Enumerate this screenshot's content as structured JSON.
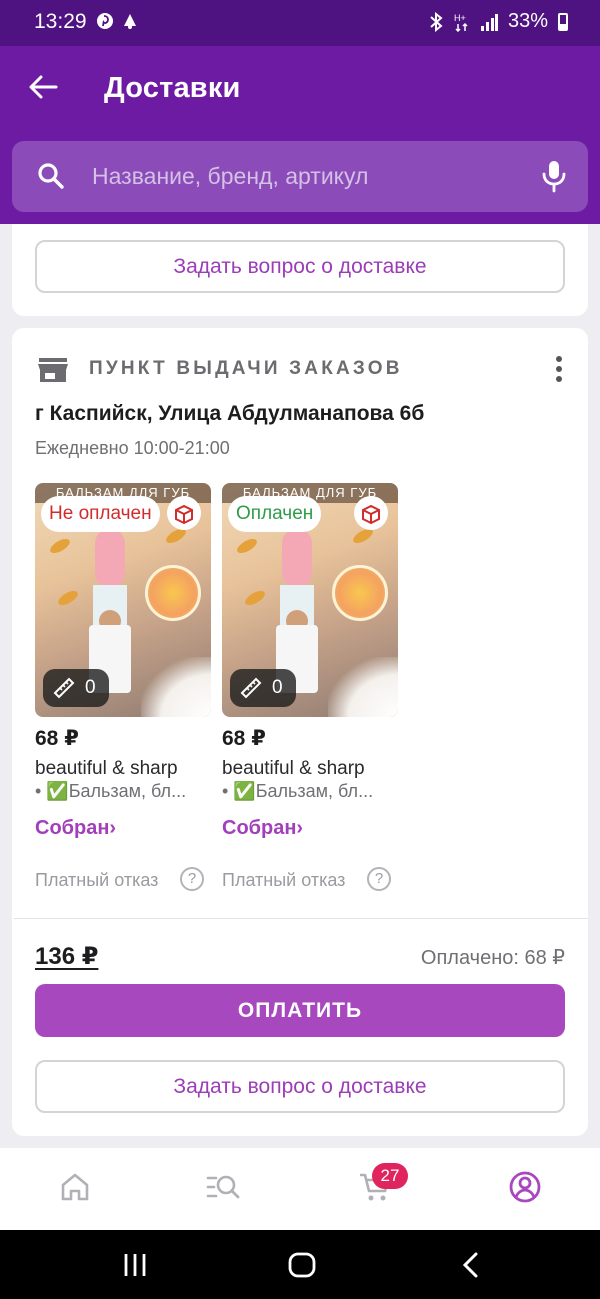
{
  "status_bar": {
    "time": "13:29",
    "battery": "33%",
    "icons": [
      "pinterest-icon",
      "notification-icon",
      "bluetooth-icon",
      "data-icon",
      "signal-icon",
      "battery-icon"
    ]
  },
  "header": {
    "title": "Доставки",
    "back_icon": "arrow-left-icon",
    "search_placeholder": "Название, бренд, артикул"
  },
  "top_card": {
    "ask_button": "Задать вопрос о доставке"
  },
  "delivery": {
    "type_label": "ПУНКТ ВЫДАЧИ ЗАКАЗОВ",
    "address": "г Каспийск, Улица Абдулманапова 6б",
    "hours": "Ежедневно 10:00-21:00",
    "items": [
      {
        "banner": "БАЛЬЗАМ ДЛЯ ГУБ",
        "payment_status": "Не оплачен",
        "status_color": "#d12c2c",
        "fitting_count": "0",
        "price": "68 ₽",
        "brand": "beautiful & sharp",
        "name": "• ✅Бальзам, бл...",
        "status": "Собран›",
        "refusal": "Платный отказ"
      },
      {
        "banner": "БАЛЬЗАМ ДЛЯ ГУБ",
        "payment_status": "Оплачен",
        "status_color": "#2f9c4a",
        "fitting_count": "0",
        "price": "68 ₽",
        "brand": "beautiful & sharp",
        "name": "• ✅Бальзам, бл...",
        "status": "Собран›",
        "refusal": "Платный отказ"
      }
    ],
    "total": "136 ₽",
    "paid": "Оплачено: 68 ₽",
    "pay_button": "ОПЛАТИТЬ",
    "ask_button": "Задать вопрос о доставке"
  },
  "bottom_nav": {
    "items": [
      "home-icon",
      "catalog-icon",
      "cart-icon",
      "profile-icon"
    ],
    "cart_count": "27",
    "active": "profile-icon"
  },
  "colors": {
    "brand_purple": "#6c1ba2",
    "accent": "#a848bf",
    "badge": "#e0245e"
  }
}
